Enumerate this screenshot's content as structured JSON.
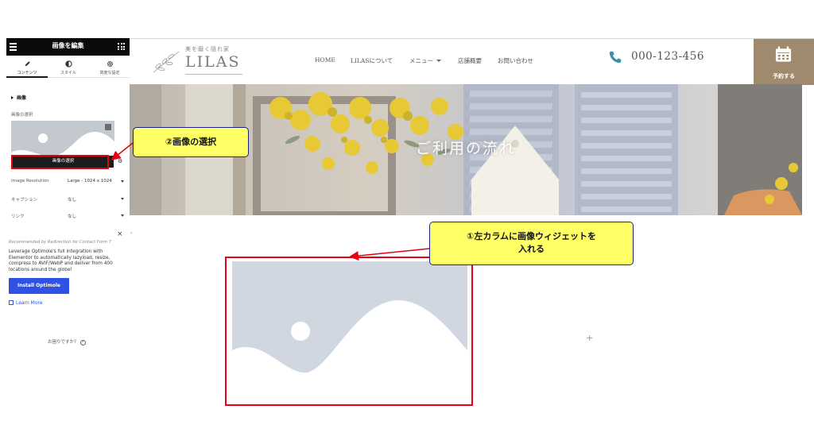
{
  "editor_panel": {
    "title": "画像を編集",
    "tabs": [
      {
        "label": "コンテンツ",
        "icon": "pencil-icon",
        "active": true
      },
      {
        "label": "スタイル",
        "icon": "half-circle-icon",
        "active": false
      },
      {
        "label": "高度な設定",
        "icon": "gear-icon",
        "active": false
      }
    ],
    "section_title": "画像",
    "choose_label": "画像の選択",
    "choose_button": "画像の選択",
    "rows": [
      {
        "label": "Image Resolution",
        "value": "Large - 1024 x 1024"
      },
      {
        "label": "キャプション",
        "value": "なし"
      },
      {
        "label": "リンク",
        "value": "なし"
      }
    ],
    "promo": {
      "close": "×",
      "title": "Recommended by Redirection for Contact Form 7",
      "text": "Leverage Optimole's full integration with Elementor to automatically lazyload, resize, compress to AVIF/WebP and deliver from 400 locations around the globe!",
      "button": "Install Optimole",
      "learn_more": "Learn More"
    },
    "help": "お困りですか？",
    "help_icon": "?",
    "collapse": "‹"
  },
  "site": {
    "logo_tagline": "美を磨く隠れ家",
    "logo_name": "LILAS",
    "nav": [
      "HOME",
      "LILASについて",
      "メニュー",
      "店舗概要",
      "お問い合わせ"
    ],
    "phone": "000-123-456",
    "reserve": "予約する",
    "hero_title": "ご利用の流れ",
    "accent_color": "#a08a6d",
    "phone_icon_color": "#3d8fa8"
  },
  "canvas": {
    "add_icon": "+"
  },
  "annotations": {
    "step2": "②画像の選択",
    "step1_line1": "①左カラムに画像ウィジェットを",
    "step1_line2": "入れる",
    "highlight_color": "#e60012",
    "callout_color": "#ffff66"
  }
}
